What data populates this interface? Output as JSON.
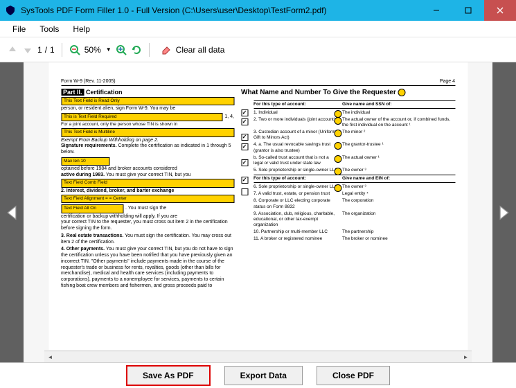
{
  "window": {
    "title": "SysTools PDF Form Filler 1.0 - Full Version (C:\\Users\\user\\Desktop\\TestForm2.pdf)"
  },
  "menu": {
    "items": [
      "File",
      "Tools",
      "Help"
    ]
  },
  "toolbar": {
    "page_current": "1",
    "page_sep": "/",
    "page_total": "1",
    "zoom": "50%",
    "clear_label": "Clear all data"
  },
  "footer": {
    "save": "Save As PDF",
    "export": "Export Data",
    "close": "Close PDF"
  },
  "doc": {
    "header_left": "Form W-9 (Rev. 11-2005)",
    "header_right": "Page 4",
    "left": {
      "part_label": "Part II.",
      "part_title": "Certification",
      "field1": "This Text Field is Read Only",
      "text1": "person, or resident alien, sign Form W-9. You may be",
      "field2": "This is Text Field Required",
      "text2a": "1, 4,",
      "text3": "For a joint account, only the person whose TIN is shown in",
      "field3": "This Text Field is Multiline",
      "text4": "Exempt From Backup Withholding on page 2.",
      "sig_head": "Signature requirements.",
      "sig_body": "Complete the certification as indicated in 1 through 5 below.",
      "text5": "optained before 1984 and broker accounts considered",
      "field4": "Max len 10",
      "text6_a": "active during 1983.",
      "text6_b": "You must give your correct TIN, but you",
      "field5": "Text Field Comb Field",
      "text7": "2. Interest, dividend, broker, and barter exchange",
      "field6": "Text Field Alignment = = Center",
      "field7": "Text Field All On",
      "text8": ". You must sign the",
      "text9": "certification or backup withholding will apply. If you are",
      "text10": "your correct TIN to the requester, you must cross out item 2 in the certification before signing the form.",
      "text11_a": "3. Real estate transactions.",
      "text11_b": "You must sign the certification. You may cross out item 2 of the certification.",
      "text12_a": "4. Other payments.",
      "text12_b": "You must give your correct TIN, but you do not have to sign the certification unless you have been notified that you have previously given an incorrect TIN. \"Other payments\" include payments made in the course of the requester's trade or business for rents, royalties, goods (other than bills for merchandise), medical and health care services (including payments to corporations), payments to a nonemployee for services, payments to certain fishing boat crew members and fishermen, and gross proceeds paid to"
    },
    "right": {
      "title": "What Name and Number To Give the Requester",
      "head1": "For this type of account:",
      "head2": "Give name and SSN of:",
      "rows1": [
        {
          "c1": "1. Individual",
          "c2": "The individual"
        },
        {
          "c1": "2. Two or more individuals (joint account)",
          "c2": "The actual owner of the account or, if combined funds, the first individual on the account ¹"
        },
        {
          "c1": "3. Custodian account of a minor (Uniform Gift to Minors Act)",
          "c2": "The minor ²"
        },
        {
          "c1": "4. a. The usual revocable savings trust (grantor is also trustee)",
          "c2": "The grantor-trustee ¹"
        },
        {
          "c1": "   b. So-called trust account that is not a legal or valid trust under state law",
          "c2": "The actual owner ¹"
        },
        {
          "c1": "5. Sole proprietorship or single-owner LLC",
          "c2": "The owner ³"
        }
      ],
      "head3": "For this type of account:",
      "head4": "Give name and EIN of:",
      "rows2": [
        {
          "c1": "6. Sole proprietorship or single-owner LLC",
          "c2": "The owner ³"
        },
        {
          "c1": "7. A valid trust, estate, or pension trust",
          "c2": "Legal entity ⁴"
        },
        {
          "c1": "8. Corporate or LLC electing corporate status on Form 8832",
          "c2": "The corporation"
        },
        {
          "c1": "9. Association, club, religious, charitable, educational, or other tax-exempt organization",
          "c2": "The organization"
        },
        {
          "c1": "10. Partnership or multi-member LLC",
          "c2": "The partnership"
        },
        {
          "c1": "11. A broker or registered nominee",
          "c2": "The broker or nominee"
        }
      ]
    }
  }
}
